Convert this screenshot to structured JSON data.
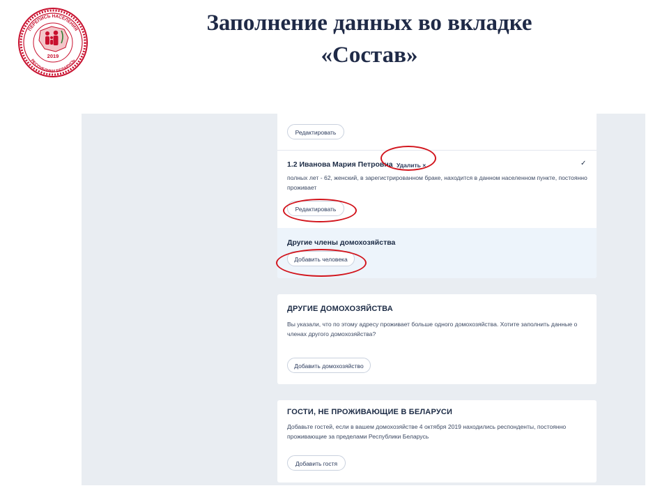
{
  "slide": {
    "title_line1": "Заполнение данных во вкладке",
    "title_line2": "«Состав»",
    "logo": {
      "top_text": "ПЕРЕПИСЬ НАСЕЛЕНИЯ",
      "year": "2019",
      "bottom_text": "РЕСПУБЛИКИ БЕЛАРУСЬ",
      "colors": {
        "ring": "#c8102e",
        "accent": "#2e7d32"
      }
    }
  },
  "form": {
    "first_person": {
      "edit_label": "Редактировать"
    },
    "second_person": {
      "name": "1.2 Иванова Мария Петровна",
      "remove_label": "Удалить ×",
      "details": "полных лет - 62, женский, в зарегистрированном браке, находится в данном населенном пункте, постоянно проживает",
      "edit_label": "Редактировать",
      "check_icon": "check-icon"
    },
    "other_members": {
      "title": "Другие члены домохозяйства",
      "add_label": "Добавить человека"
    },
    "other_households": {
      "title": "ДРУГИЕ ДОМОХОЗЯЙСТВА",
      "text": "Вы указали, что по этому адресу проживает больше одного домохозяйства. Хотите заполнить данные о членах другого домохозяйства?",
      "add_label": "Добавить домохозяйство"
    },
    "guests": {
      "title": "ГОСТИ, НЕ ПРОЖИВАЮЩИЕ В БЕЛАРУСИ",
      "text": "Добавьте гостей, если в вашем домохозяйстве 4 октября 2019 находились респонденты, постоянно проживающие за пределами Республики Беларусь",
      "add_label": "Добавить гостя"
    }
  },
  "highlight_color": "#d2141c"
}
